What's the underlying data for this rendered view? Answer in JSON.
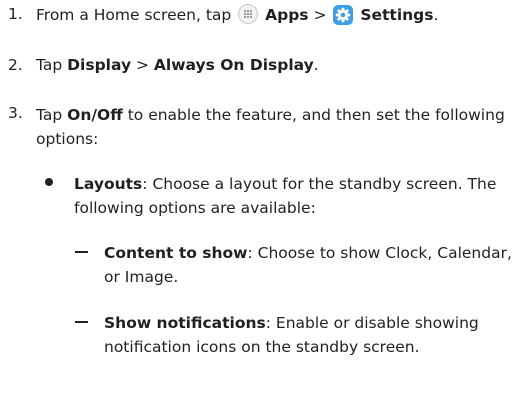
{
  "steps": [
    {
      "num": "1.",
      "pre": "From a Home screen, tap ",
      "apps": "Apps",
      "sep": " > ",
      "settings": "Settings",
      "post": "."
    },
    {
      "num": "2.",
      "pre": "Tap ",
      "display": "Display",
      "sep": " > ",
      "aod": "Always On Display",
      "post": "."
    },
    {
      "num": "3.",
      "pre": "Tap ",
      "onoff": "On/Off",
      "post": " to enable the feature, and then set the following options:"
    }
  ],
  "bullet": {
    "term": "Layouts",
    "desc": ": Choose a layout for the standby screen. The following options are available:"
  },
  "subitems": [
    {
      "term": "Content to show",
      "desc": ": Choose to show Clock, Calendar, or Image."
    },
    {
      "term": "Show notifications",
      "desc": ": Enable or disable showing notification icons on the standby screen."
    }
  ],
  "icons": {
    "apps": "apps-grid-icon",
    "settings": "settings-gear-icon"
  },
  "colors": {
    "text": "#231f20",
    "settings_icon_bg": "#3d9ee6"
  }
}
